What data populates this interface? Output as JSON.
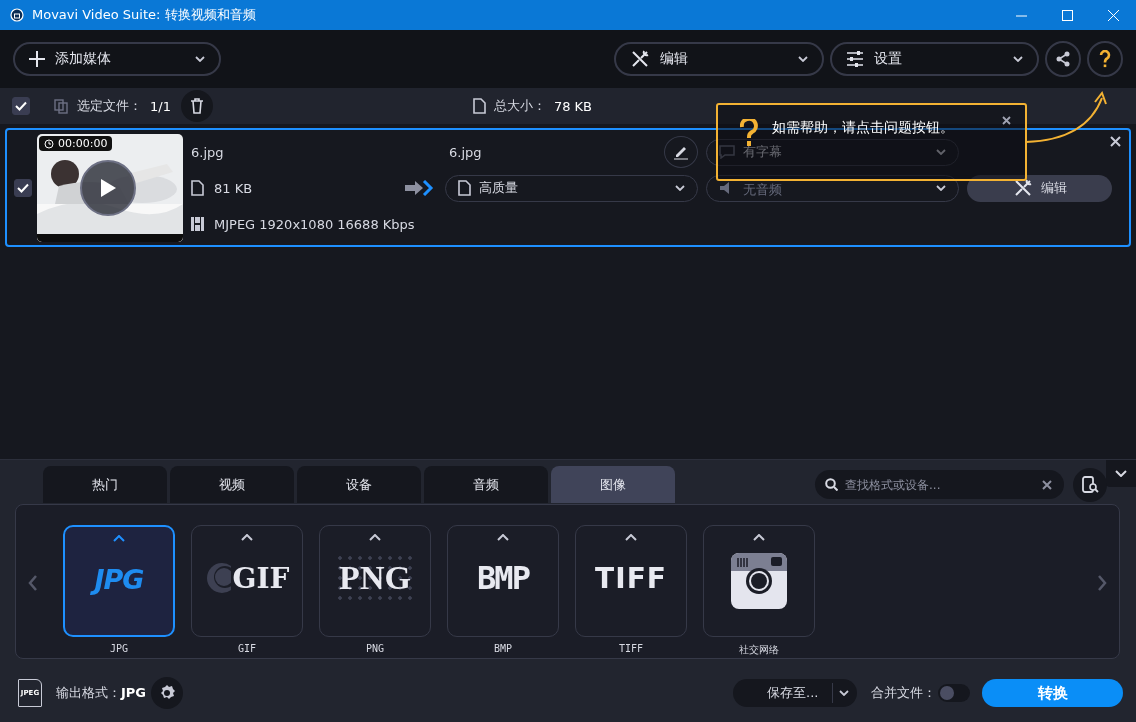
{
  "window": {
    "title": "Movavi Video Suite: 转换视频和音频"
  },
  "toolbar": {
    "add_media": "添加媒体",
    "edit": "编辑",
    "settings": "设置"
  },
  "selection_bar": {
    "all_checked": true,
    "selected_label": "选定文件：",
    "selected_count": "1/1",
    "total_label": "总大小：",
    "total_size": "78 KB"
  },
  "file": {
    "checked": true,
    "duration": "00:00:00",
    "source_name": "6.jpg",
    "source_size": "81 KB",
    "source_info": "MJPEG 1920x1080 16688 Kbps",
    "output_name": "6.jpg",
    "preset": "高质量",
    "subtitles": "有字幕",
    "audio": "无音频",
    "edit_button": "编辑"
  },
  "help_tip": {
    "text": "如需帮助，请点击问题按钮。"
  },
  "format_tabs": [
    {
      "label": "热门",
      "selected": false
    },
    {
      "label": "视频",
      "selected": false
    },
    {
      "label": "设备",
      "selected": false
    },
    {
      "label": "音频",
      "selected": false
    },
    {
      "label": "图像",
      "selected": true
    }
  ],
  "search": {
    "placeholder": "查找格式或设备..."
  },
  "formats": [
    {
      "kind": "jpg",
      "logo": "JPG",
      "label": "JPG",
      "selected": true
    },
    {
      "kind": "gif",
      "logo": "GIF",
      "label": "GIF",
      "selected": false
    },
    {
      "kind": "png",
      "logo": "PNG",
      "label": "PNG",
      "selected": false
    },
    {
      "kind": "bmp",
      "logo": "BMP",
      "label": "BMP",
      "selected": false
    },
    {
      "kind": "tiff",
      "logo": "TIFF",
      "label": "TIFF",
      "selected": false
    },
    {
      "kind": "camera",
      "label": "社交网络",
      "selected": false
    }
  ],
  "footer": {
    "output_icon_text": "JPEG",
    "output_format": "输出格式：**JPG**",
    "save_to": "保存至...",
    "merge_label": "合并文件：",
    "merge_on": false,
    "convert": "转换"
  }
}
